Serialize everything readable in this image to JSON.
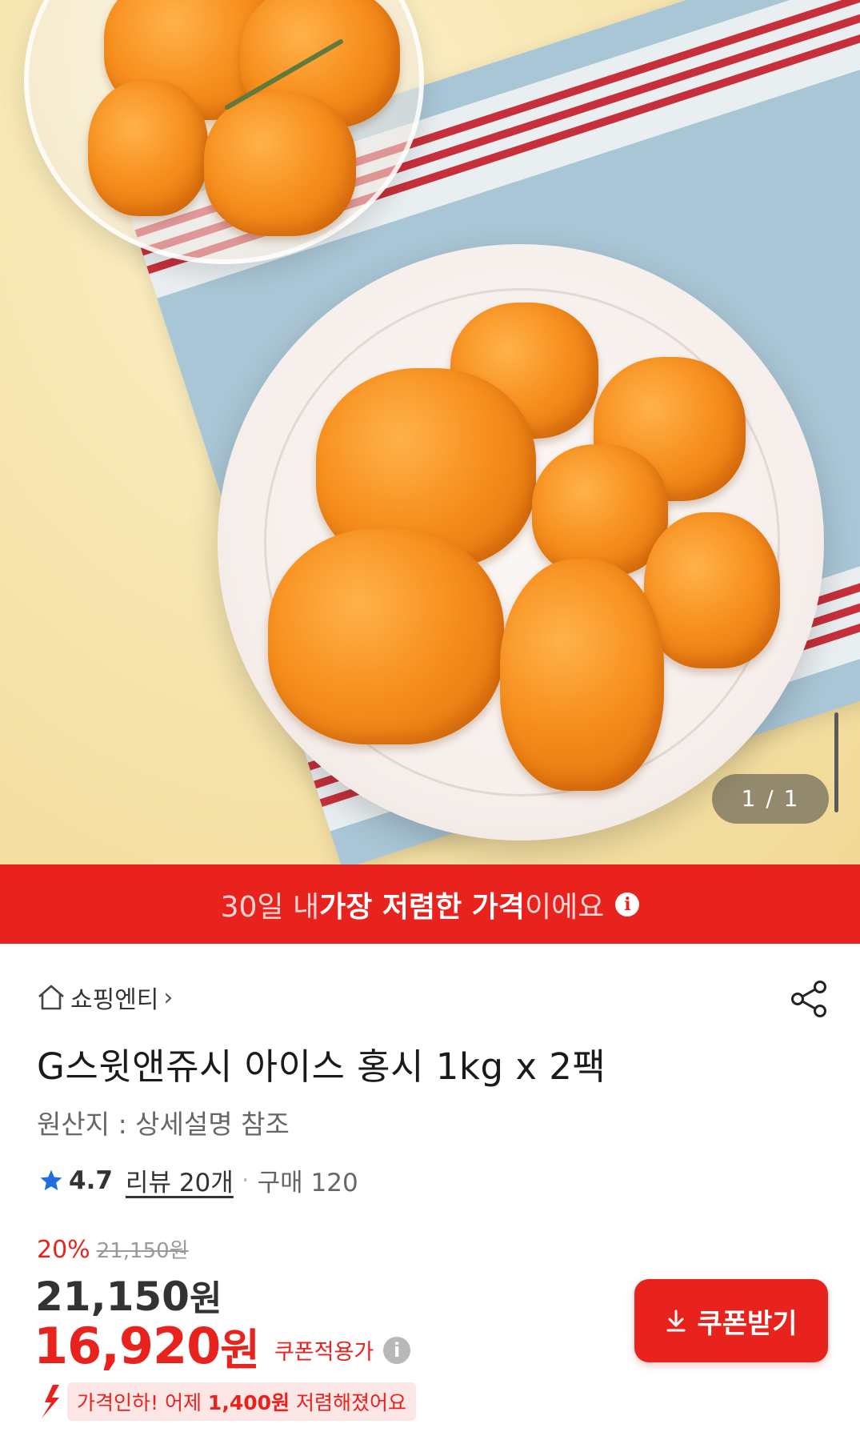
{
  "hero": {
    "counter": "1 / 1",
    "image_alt": "frozen persimmons on a plate"
  },
  "banner": {
    "prefix": "30일 내 ",
    "highlight": "가장 저렴한 가격",
    "suffix": "이에요",
    "info_icon": "i"
  },
  "store": {
    "name": "쇼핑엔티",
    "chevron": "›"
  },
  "product": {
    "title": "G스윗앤쥬시 아이스 홍시 1kg x 2팩",
    "origin": "원산지 : 상세설명 참조"
  },
  "rating": {
    "score": "4.7",
    "reviews": "리뷰 20개",
    "separator": "·",
    "purchases": "구매 120"
  },
  "pricing": {
    "discount_pct": "20%",
    "original_price": "21,150원",
    "price_amount": "21,150",
    "price_unit": "원",
    "coupon_amount": "16,920",
    "coupon_unit": "원",
    "coupon_label": "쿠폰적용가",
    "help_icon": "i",
    "drop_prefix": "가격인하! 어제 ",
    "drop_amount": "1,400원",
    "drop_suffix": " 저렴해졌어요"
  },
  "actions": {
    "coupon_button": "쿠폰받기"
  },
  "colors": {
    "accent": "#e8231e",
    "star": "#1f6fe0"
  }
}
